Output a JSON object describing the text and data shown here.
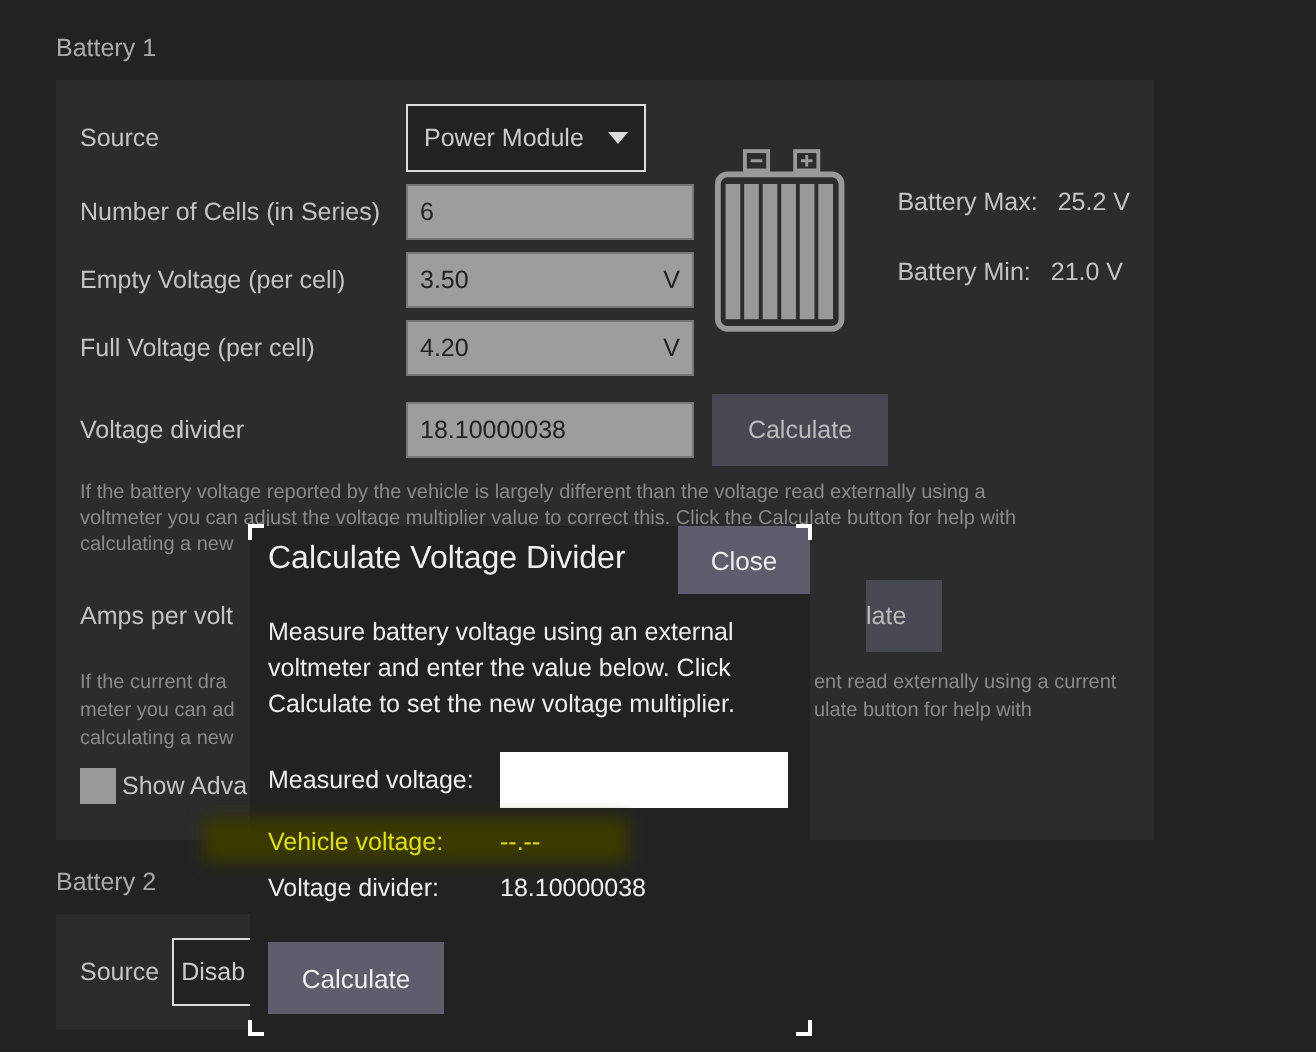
{
  "battery1": {
    "title": "Battery 1",
    "source": {
      "label": "Source",
      "value": "Power Module"
    },
    "fields": [
      {
        "label": "Number of Cells (in Series)",
        "value": "6"
      },
      {
        "label": "Empty Voltage (per cell)",
        "value": "3.50",
        "unit": "V"
      },
      {
        "label": "Full Voltage (per cell)",
        "value": "4.20",
        "unit": "V"
      }
    ],
    "battery_max": {
      "label": "Battery Max:",
      "value": "25.2 V"
    },
    "battery_min": {
      "label": "Battery Min:",
      "value": "21.0 V"
    },
    "voltage_divider": {
      "label": "Voltage divider",
      "value": "18.10000038",
      "button": "Calculate"
    },
    "voltage_help": [
      "If the battery voltage reported by the vehicle is largely different than the voltage read externally using a",
      "voltmeter you can adjust the voltage multiplier value to correct this. Click the Calculate button for help with",
      "calculating a new"
    ],
    "amps_per_volt": {
      "label": "Amps per volt",
      "button": "late"
    },
    "amps_help": {
      "left": [
        "If the current dra",
        "meter you can ad",
        "calculating a new"
      ],
      "right": [
        "ent read externally using a current",
        "ulate button for help with"
      ]
    },
    "show_advanced": {
      "label": "Show Adva",
      "checked": false
    }
  },
  "battery2": {
    "title": "Battery 2",
    "source": {
      "label": "Source",
      "value": "Disab"
    }
  },
  "dialog": {
    "title": "Calculate Voltage Divider",
    "close": "Close",
    "message": "Measure battery voltage using an external voltmeter and enter the value below. Click Calculate to set the new voltage multiplier.",
    "measured": {
      "label": "Measured voltage:"
    },
    "rows": [
      {
        "label": "Vehicle voltage:",
        "value": "--.--",
        "highlighted": true
      },
      {
        "label": "Voltage divider:",
        "value": "18.10000038",
        "highlighted": false
      }
    ],
    "button": "Calculate"
  }
}
